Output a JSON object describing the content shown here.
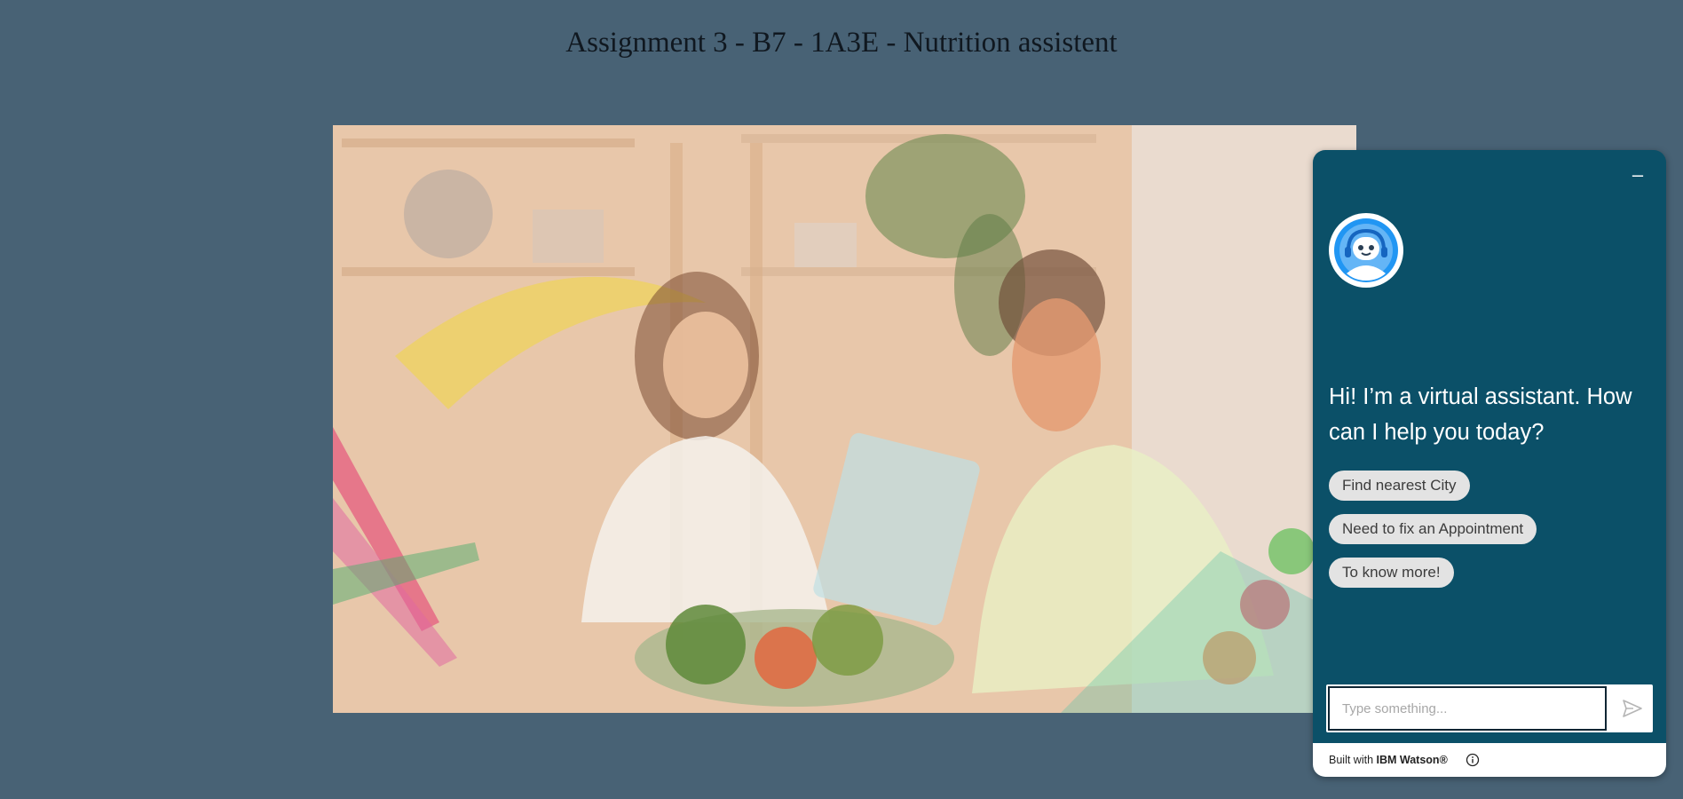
{
  "page": {
    "title": "Assignment 3 - B7 - 1A3E - Nutrition assistent",
    "background_color": "#486275"
  },
  "hero_image": {
    "icon": "nutritionist-consultation-photo"
  },
  "chat_widget": {
    "background_color": "#0b5068",
    "minimize_icon": "minimize-icon",
    "avatar_icon": "bot-avatar-icon",
    "greeting": "Hi! I’m a virtual assistant. How can I help you today?",
    "options": [
      {
        "label": "Find nearest City"
      },
      {
        "label": "Need to fix an Appointment"
      },
      {
        "label": "To know more!"
      }
    ],
    "input": {
      "placeholder": "Type something...",
      "value": ""
    },
    "send_icon": "send-icon",
    "footer": {
      "built_with": "Built with",
      "brand": "IBM Watson®",
      "info_icon": "info-icon"
    }
  }
}
